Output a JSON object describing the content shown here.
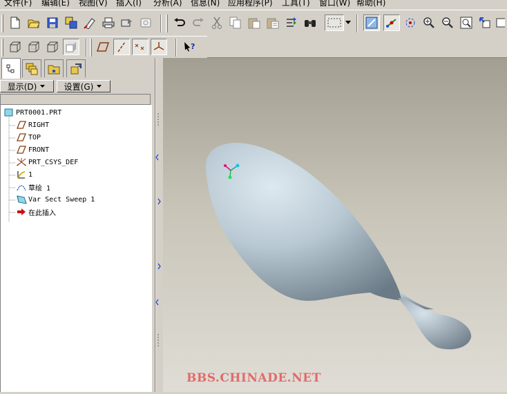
{
  "menu": [
    "文件(F)",
    "编辑(E)",
    "视图(V)",
    "插入(I)",
    "分析(A)",
    "信息(N)",
    "应用程序(P)",
    "工具(T)",
    "窗口(W)",
    "帮助(H)"
  ],
  "toolbar1_icons": [
    "new-file-icon",
    "open-folder-icon",
    "save-icon",
    "save-copy-icon",
    "erase-icon",
    "print-icon",
    "send-icon",
    "close-window-icon",
    "undo-icon",
    "redo-icon",
    "cut-icon",
    "copy-icon",
    "paste-icon",
    "paste-special-icon",
    "regenerate-icon",
    "find-icon",
    "select-box-icon",
    "select-dropdown-icon",
    "repaint-icon",
    "spin-center-icon",
    "orient-mode-icon",
    "zoom-in-icon",
    "zoom-out-icon",
    "refit-icon",
    "reorient-icon",
    "saved-views-icon"
  ],
  "toolbar2_icons": [
    "wireframe-icon",
    "hidden-line-icon",
    "no-hidden-icon",
    "shading-icon",
    "datum-planes-icon",
    "datum-axes-icon",
    "datum-points-icon",
    "coord-systems-icon",
    "context-help-icon"
  ],
  "navigator": {
    "tabs": [
      "model-tree-tab",
      "layers-tab",
      "folder-browser-tab",
      "favorites-tab"
    ],
    "show_button": "显示(D)",
    "settings_button": "设置(G)"
  },
  "tree": [
    {
      "label": "PRT0001.PRT",
      "icon": "part-icon"
    },
    {
      "label": "RIGHT",
      "icon": "datum-plane-icon"
    },
    {
      "label": "TOP",
      "icon": "datum-plane-icon"
    },
    {
      "label": "FRONT",
      "icon": "datum-plane-icon"
    },
    {
      "label": "PRT_CSYS_DEF",
      "icon": "coord-system-icon"
    },
    {
      "label": "1",
      "icon": "datum-curve-icon"
    },
    {
      "label": "草绘 1",
      "icon": "sketch-icon"
    },
    {
      "label": "Var Sect Sweep 1",
      "icon": "sweep-icon"
    },
    {
      "label": "在此插入",
      "icon": "insert-here-arrow-icon"
    }
  ],
  "viewport": {
    "watermark": "BBS.CHINADE.NET",
    "model": "spoon-shaped-solid"
  },
  "colors": {
    "ui_gray": "#d4d0c8",
    "viewport_top": "#a29e92",
    "viewport_bottom": "#e0ddd6",
    "model_body": "#b8c8d2",
    "watermark": "#e06b6b"
  }
}
